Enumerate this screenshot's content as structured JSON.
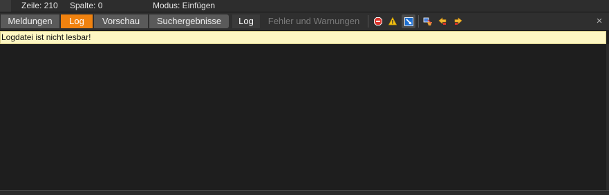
{
  "statusbar": {
    "line": "Zeile: 210",
    "column": "Spalte: 0",
    "mode": "Modus: Einfügen"
  },
  "tabs": [
    {
      "label": "Meldungen",
      "active": false
    },
    {
      "label": "Log",
      "active": true
    },
    {
      "label": "Vorschau",
      "active": false
    },
    {
      "label": "Suchergebnisse",
      "active": false
    }
  ],
  "subtabs": [
    {
      "label": "Log",
      "active": true
    },
    {
      "label": "Fehler und Warnungen",
      "active": false
    }
  ],
  "toolbar": {
    "icons": [
      "stop-error-icon",
      "warning-icon",
      "info-toggle-icon",
      "clear-log-icon",
      "previous-arrow-icon",
      "next-arrow-icon"
    ],
    "close_glyph": "×"
  },
  "message": {
    "text": "Logdatei ist nicht lesbar!"
  },
  "colors": {
    "accent": "#f0820f",
    "message_bg": "#fdf6c2",
    "background": "#1e1e1e"
  }
}
